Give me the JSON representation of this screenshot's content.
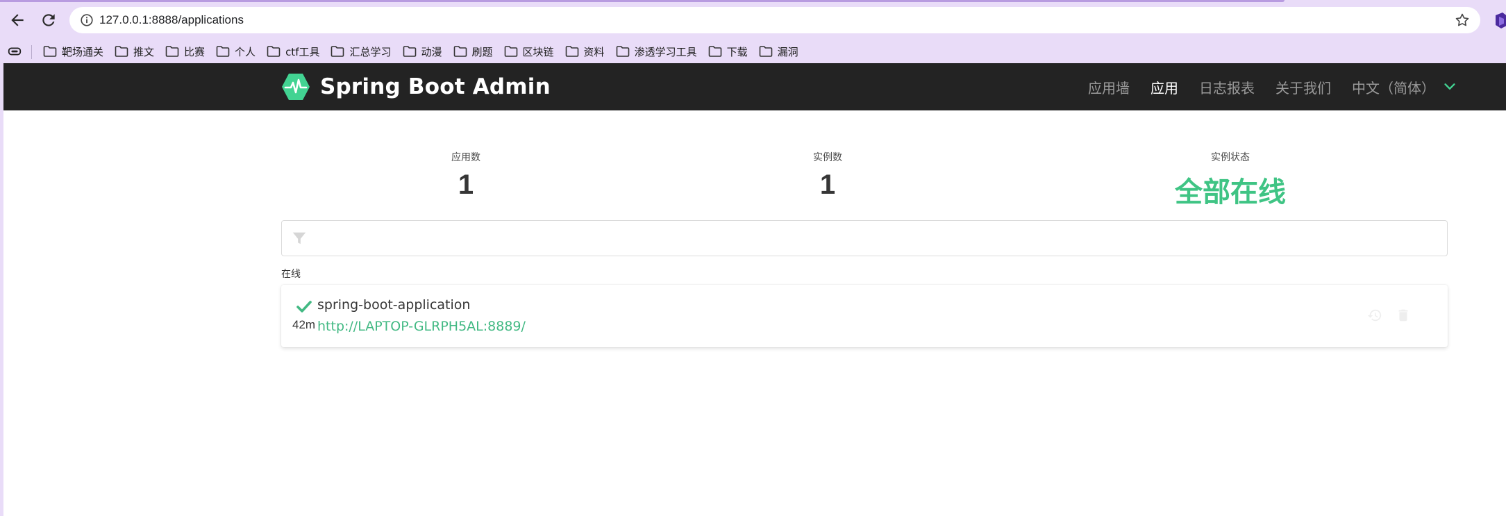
{
  "browser": {
    "url": "127.0.0.1:8888/applications",
    "bookmarks": [
      "靶场通关",
      "推文",
      "比赛",
      "个人",
      "ctf工具",
      "汇总学习",
      "动漫",
      "刷题",
      "区块链",
      "资料",
      "渗透学习工具",
      "下载",
      "漏洞"
    ]
  },
  "navbar": {
    "brand": "Spring Boot Admin",
    "links": [
      "应用墙",
      "应用",
      "日志报表",
      "关于我们"
    ],
    "active_index": 1,
    "language": "中文（简体）"
  },
  "stats": {
    "apps_label": "应用数",
    "apps_value": "1",
    "instances_label": "实例数",
    "instances_value": "1",
    "status_label": "实例状态",
    "status_value": "全部在线"
  },
  "filter": {
    "placeholder": ""
  },
  "group": {
    "label": "在线",
    "apps": [
      {
        "name": "spring-boot-application",
        "url": "http://LAPTOP-GLRPH5AL:8889/",
        "uptime": "42m"
      }
    ]
  },
  "colors": {
    "accent": "#42b983",
    "navbar": "#232323",
    "browser_chrome": "#e9dcf8"
  }
}
